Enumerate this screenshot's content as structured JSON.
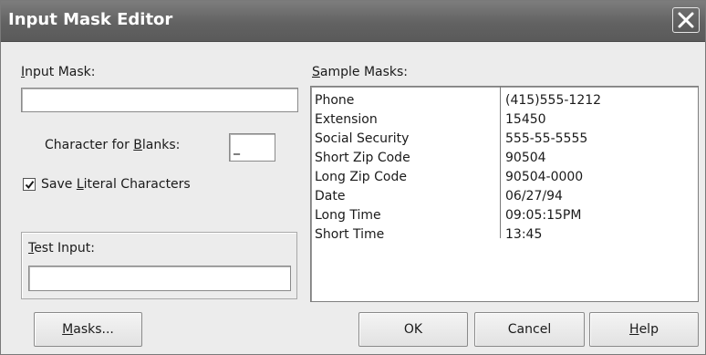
{
  "window": {
    "title": "Input Mask Editor"
  },
  "input_mask": {
    "label_key": "I",
    "label_rest": "nput Mask:",
    "value": ""
  },
  "blanks": {
    "label_pre": "Character for ",
    "label_key": "B",
    "label_rest": "lanks:",
    "value": "_"
  },
  "literal": {
    "checked": true,
    "label_pre": "Save ",
    "label_key": "L",
    "label_rest": "iteral Characters"
  },
  "test_input": {
    "label_key": "T",
    "label_rest": "est Input:",
    "value": ""
  },
  "samples": {
    "label_key": "S",
    "label_rest": "ample Masks:",
    "rows": [
      {
        "name": "Phone",
        "value": "(415)555-1212"
      },
      {
        "name": "Extension",
        "value": "15450"
      },
      {
        "name": "Social Security",
        "value": "555-55-5555"
      },
      {
        "name": "Short Zip Code",
        "value": "90504"
      },
      {
        "name": "Long Zip Code",
        "value": "90504-0000"
      },
      {
        "name": "Date",
        "value": "06/27/94"
      },
      {
        "name": "Long Time",
        "value": "09:05:15PM"
      },
      {
        "name": "Short Time",
        "value": "13:45"
      }
    ]
  },
  "buttons": {
    "masks_key": "M",
    "masks_rest": "asks...",
    "ok": "OK",
    "cancel": "Cancel",
    "help_key": "H",
    "help_rest": "elp"
  }
}
